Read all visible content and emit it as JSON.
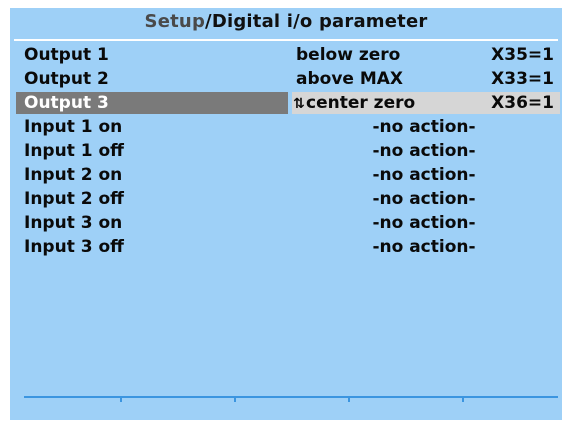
{
  "header": {
    "crumb": "Setup",
    "separator": "/",
    "title": "Digital i/o parameter"
  },
  "rows": [
    {
      "label": "Output 1",
      "value": "below zero",
      "code": "X35=1"
    },
    {
      "label": "Output 2",
      "value": "above MAX",
      "code": "X33=1"
    },
    {
      "label": "Output 3",
      "value": "center zero",
      "code": "X36=1",
      "selected": true
    },
    {
      "label": "Input 1 on",
      "value": "-no action-"
    },
    {
      "label": "Input 1 off",
      "value": "-no action-"
    },
    {
      "label": "Input 2 on",
      "value": "-no action-"
    },
    {
      "label": "Input 2 off",
      "value": "-no action-"
    },
    {
      "label": "Input 3 on",
      "value": "-no action-"
    },
    {
      "label": "Input 3 off",
      "value": "-no action-"
    }
  ],
  "selected_value_icon": "up-down-arrow-icon",
  "colors": {
    "screen_background": "#9ed0f7",
    "selected_label_background": "#7a7a7a",
    "selected_value_background": "#d6d6d6",
    "footer_line": "#3b95e0"
  }
}
